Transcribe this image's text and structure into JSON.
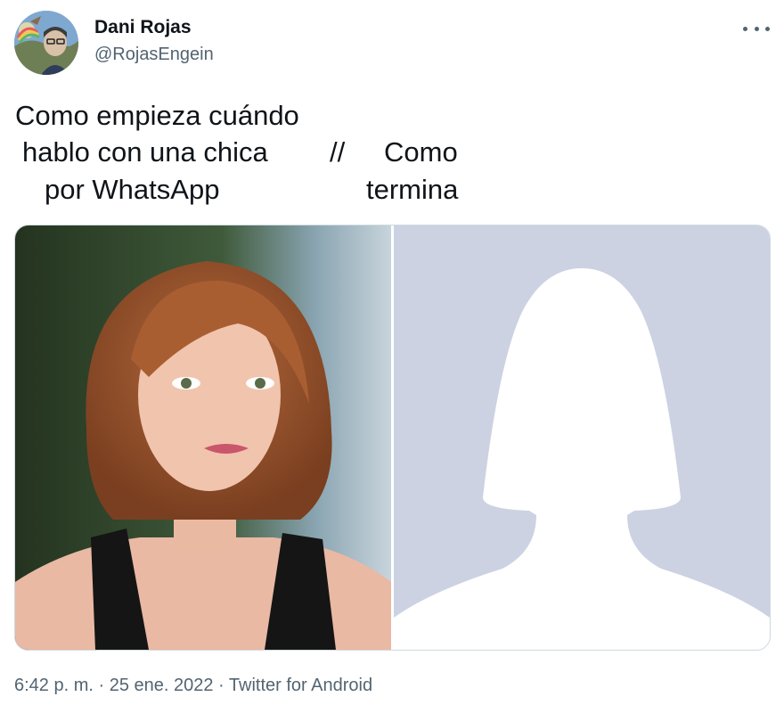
{
  "author": {
    "display_name": "Dani Rojas",
    "handle": "@RojasEngein",
    "avatar_icon": "profile-avatar"
  },
  "menu": {
    "icon": "more-options-icon"
  },
  "tweet_text": {
    "line1": "Como empieza cuándo",
    "line2_left": "hablo con una chica",
    "separator": "//",
    "line2_right": "Como",
    "line3_left": "por WhatsApp",
    "line3_right": "termina"
  },
  "media": {
    "left_image": "woman-portrait-photo",
    "right_image": "default-female-silhouette-avatar",
    "silhouette_background": "#ccd2e2"
  },
  "footer": {
    "time": "6:42 p. m.",
    "dot1": " · ",
    "date": "25 ene. 2022",
    "dot2": " · ",
    "source": "Twitter for Android"
  },
  "colors": {
    "text_primary": "#0f1419",
    "text_secondary": "#536471",
    "border": "#cfd9de"
  }
}
